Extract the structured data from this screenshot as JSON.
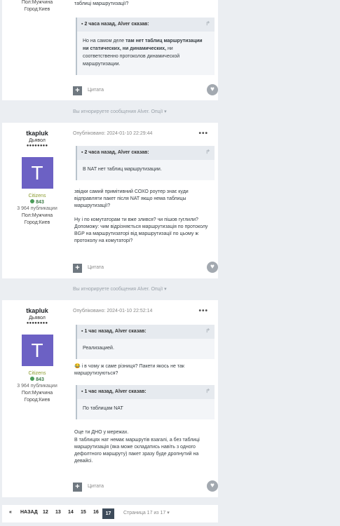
{
  "post0": {
    "author_meta": [
      "Пол:Мужчина",
      "Город:Киев"
    ],
    "top_text": "таблиці маршрутизації?",
    "quote": {
      "header": "2 часа назад, Alver сказав:",
      "body_pre": "Но на самом деле ",
      "body_bold": "там нет  таблиц маршрутизации ни статических, ни динамических,",
      "body_post": " ни соответственно протоколов динамической маршрутизации."
    },
    "cite_label": "Цитата"
  },
  "ignore_text": "Вы игнорируете сообщения Alver. Опції",
  "post1": {
    "author": {
      "name": "tkapluk",
      "rank": "Дьявол",
      "pips": "●●●●●●●●",
      "avatar_letter": "T",
      "group": "Citizens",
      "rep": "843",
      "pubs": "3 964 публикации",
      "gender": "Пол:Мужчина",
      "city": "Город:Киев"
    },
    "date": "Опубліковано: 2024-01-10 22:29:44",
    "menu": "•••",
    "quote": {
      "header": "2 часа назад, Alver сказав:",
      "body": "В NAT нет таблиц маршрутизации."
    },
    "para1": "звідки самий примітивний СОХО роутер знає куди відправляти пакет після NAT якщо нема таблицы маршрутизації?",
    "para2": "Ну і по комутаторам ти вже злився? чи пішов гуглили? Допоможу: чим відрізняється маршрутизація по протоколу BGP на маршрутизаторі від маршрутизації по цьому ж протоколу на комутаторі?",
    "cite_label": "Цитата"
  },
  "post2": {
    "author": {
      "name": "tkapluk",
      "rank": "Дьявол",
      "pips": "●●●●●●●●",
      "avatar_letter": "T",
      "group": "Citizens",
      "rep": "843",
      "pubs": "3 964 публикации",
      "gender": "Пол:Мужчина",
      "city": "Город:Киев"
    },
    "date": "Опубліковано: 2024-01-10 22:52:14",
    "menu": "•••",
    "quote1": {
      "header": "1 час назад, Alver сказав:",
      "body": "Реализацией."
    },
    "para1": "😂 і в чому ж саме різниця? Пакети якось не так маршрутизуються?",
    "quote2": {
      "header": "1 час назад, Alver сказав:",
      "body": "По таблицам NAT"
    },
    "para2": "Оце ти ДНО у мережах.",
    "para3": "В таблицях нат немає маршрутів взагалі, а без таблиці маршрутизація (яка може складатись навіть з одного дефолтного маршруту) пакет зразу буде дропнутий на девайсі.",
    "cite_label": "Цитата"
  },
  "pagination": {
    "first": "«",
    "back": "НАЗАД",
    "pages": [
      "12",
      "13",
      "14",
      "15",
      "16"
    ],
    "current": "17",
    "info": "Страница 17 из 17"
  },
  "icons": {
    "quote_arrow": "↱",
    "heart": "♥",
    "plus": "+",
    "caret": "▾"
  }
}
